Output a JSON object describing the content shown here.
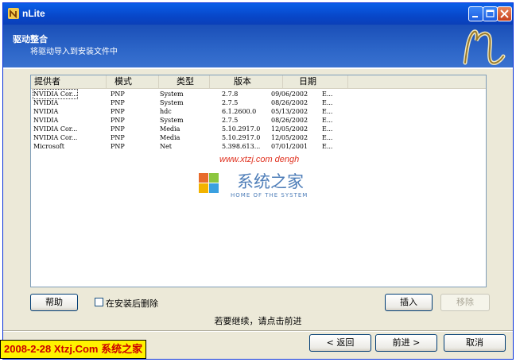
{
  "window": {
    "title": "nLite",
    "header_title": "驱动整合",
    "header_subtitle": "将驱动导入到安装文件中"
  },
  "columns": [
    "提供者",
    "模式",
    "类型",
    "版本",
    "日期"
  ],
  "rows": [
    {
      "provider": "NVIDIA Cor...",
      "mode": "PNP",
      "type": "System",
      "version": "2.7.8",
      "date": "09/06/2002",
      "extra": "E..."
    },
    {
      "provider": "NVIDIA",
      "mode": "PNP",
      "type": "System",
      "version": "2.7.5",
      "date": "08/26/2002",
      "extra": "E..."
    },
    {
      "provider": "NVIDIA",
      "mode": "PNP",
      "type": "hdc",
      "version": "6.1.2600.0",
      "date": "05/13/2002",
      "extra": "E..."
    },
    {
      "provider": "NVIDIA",
      "mode": "PNP",
      "type": "System",
      "version": "2.7.5",
      "date": "08/26/2002",
      "extra": "E..."
    },
    {
      "provider": "NVIDIA Cor...",
      "mode": "PNP",
      "type": "Media",
      "version": "5.10.2917.0",
      "date": "12/05/2002",
      "extra": "E..."
    },
    {
      "provider": "NVIDIA Cor...",
      "mode": "PNP",
      "type": "Media",
      "version": "5.10.2917.0",
      "date": "12/05/2002",
      "extra": "E..."
    },
    {
      "provider": "Microsoft",
      "mode": "PNP",
      "type": "Net",
      "version": "5.398.613...",
      "date": "07/01/2001",
      "extra": "E..."
    }
  ],
  "buttons": {
    "help": "帮助",
    "delete_after_install": "在安装后删除",
    "insert": "插入",
    "remove": "移除",
    "back": "< 返回",
    "next": "前进 >",
    "cancel": "取消"
  },
  "status_text": "若要继续，请点击前进",
  "watermarks": {
    "url": "www.xtzj.com dengh",
    "site_name": "系统之家",
    "site_sub": "HOME OF THE SYSTEM",
    "date_banner": "2008-2-28 Xtzj.Com 系统之家"
  },
  "colors": {
    "titlebar": "#0a5fe8",
    "header_bg": "#2d66c8",
    "window_bg": "#ece9d8",
    "banner_yellow": "#fff200",
    "banner_red": "#cc0000"
  }
}
